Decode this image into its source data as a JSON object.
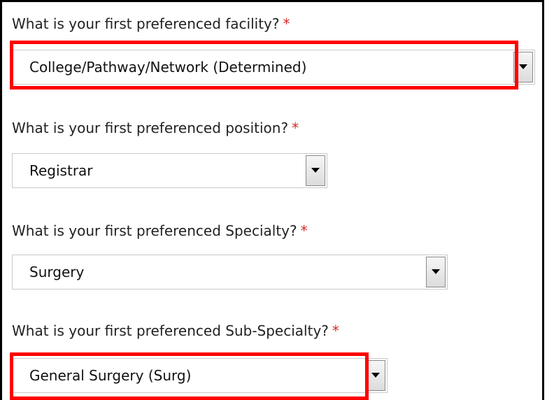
{
  "required_marker": "*",
  "questions": [
    {
      "label": "What is your first preferenced facility?",
      "value": "College/Pathway/Network (Determined)"
    },
    {
      "label": "What is your first preferenced position?",
      "value": "Registrar"
    },
    {
      "label": "What is your first preferenced Specialty?",
      "value": "Surgery"
    },
    {
      "label": "What is your first preferenced Sub-Specialty?",
      "value": "General Surgery (Surg)"
    }
  ],
  "icons": {
    "dropdown": "chevron-down-icon"
  },
  "colors": {
    "highlight": "#ff0000",
    "required": "#d62828",
    "frame": "#000000"
  }
}
